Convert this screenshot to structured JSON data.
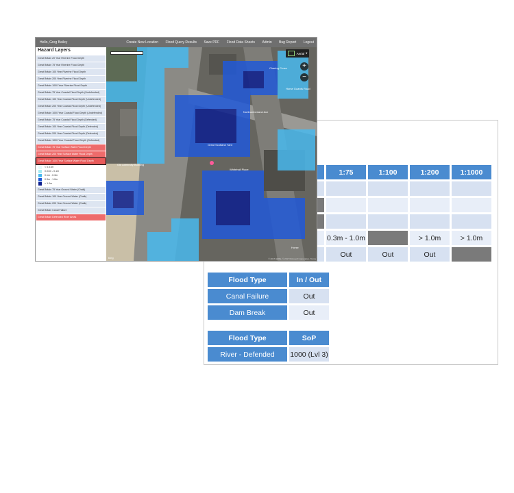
{
  "topbar": {
    "greeting": "Hello, Greg Bailey",
    "nav": [
      "Create New Location",
      "Flood Query Results",
      "Save PDF",
      "Flood Data Sheets",
      "Admin",
      "Bug Report",
      "Logout"
    ]
  },
  "sidebar": {
    "title": "Hazard Layers",
    "layers_top": [
      {
        "label": "Great Britain 20 Year Riverine Flood Depth",
        "style": "normal"
      },
      {
        "label": "Great Britain 75 Year Riverine Flood Depth",
        "style": "normal"
      },
      {
        "label": "Great Britain 100 Year Riverine Flood Depth",
        "style": "normal"
      },
      {
        "label": "Great Britain 200 Year Riverine Flood Depth",
        "style": "normal"
      },
      {
        "label": "Great Britain 1000 Year Riverine Flood Depth",
        "style": "normal"
      },
      {
        "label": "Great Britain 75 Year Coastal Flood Depth (Undefended)",
        "style": "normal"
      },
      {
        "label": "Great Britain 100 Year Coastal Flood Depth (Undefended)",
        "style": "normal"
      },
      {
        "label": "Great Britain 200 Year Coastal Flood Depth (Undefended)",
        "style": "normal"
      },
      {
        "label": "Great Britain 1000 Year Coastal Flood Depth (Undefended)",
        "style": "normal"
      },
      {
        "label": "Great Britain 75 Year Coastal Flood Depth (Defended)",
        "style": "normal"
      },
      {
        "label": "Great Britain 100 Year Coastal Flood Depth (Defended)",
        "style": "normal"
      },
      {
        "label": "Great Britain 200 Year Coastal Flood Depth (Defended)",
        "style": "normal"
      },
      {
        "label": "Great Britain 1000 Year Coastal Flood Depth (Defended)",
        "style": "normal"
      },
      {
        "label": "Great Britain 75 Year Surface Water Flood Depth",
        "style": "red"
      },
      {
        "label": "Great Britain 200 Year Surface Water Flood Depth",
        "style": "red"
      },
      {
        "label": "Great Britain 1000 Year Surface Water Flood Depth",
        "style": "active"
      }
    ],
    "legend": [
      {
        "label": "< 0.01m",
        "color": "#e6fbfb"
      },
      {
        "label": "0.01m - 0.1m",
        "color": "#a6ecf4"
      },
      {
        "label": "0.1m - 0.3m",
        "color": "#49b9ee"
      },
      {
        "label": "0.3m - 1.0m",
        "color": "#2159d8"
      },
      {
        "label": "> 1.0m",
        "color": "#0d1f8e"
      }
    ],
    "layers_bottom": [
      {
        "label": "Great Britain 75 Year Ground Water (Chalk)",
        "style": "normal"
      },
      {
        "label": "Great Britain 100 Year Ground Water (Chalk)",
        "style": "normal"
      },
      {
        "label": "Great Britain 200 Year Ground Water (Chalk)",
        "style": "normal"
      },
      {
        "label": "Great Britain Canal Failure",
        "style": "normal"
      },
      {
        "label": "Great Britain Defended River Areas",
        "style": "red"
      }
    ]
  },
  "map": {
    "labels": [
      "Charing Cross",
      "Old Admiralty Building",
      "Great Scotland Yard",
      "Whitehall Place",
      "Horse Guards Road",
      "Northumberland Ave",
      "Horse"
    ],
    "aerial_label": "Aerial",
    "zoom_in": "+",
    "zoom_out": "−",
    "attribution": "© 2017 HERE, © 2017 Microsoft Corporation, Terms",
    "brand": "bing"
  },
  "return_table": {
    "headers": [
      "1:75",
      "1:100",
      "1:200",
      "1:1000"
    ],
    "rows": [
      {
        "stub": "",
        "cells": [
          "",
          "",
          "",
          ""
        ]
      },
      {
        "stub": "",
        "cells": [
          "",
          "",
          "",
          ""
        ]
      },
      {
        "stub": "",
        "cells": [
          "",
          "",
          "",
          ""
        ]
      },
      {
        "stub": "",
        "cells": [
          "0.3m - 1.0m",
          "",
          "> 1.0m",
          "> 1.0m"
        ]
      },
      {
        "stub": "",
        "cells": [
          "Out",
          "Out",
          "Out",
          ""
        ]
      }
    ]
  },
  "flood_table_1": {
    "headers": [
      "Flood Type",
      "In / Out"
    ],
    "rows": [
      [
        "Canal Failure",
        "Out"
      ],
      [
        "Dam Break",
        "Out"
      ]
    ]
  },
  "flood_table_2": {
    "headers": [
      "Flood Type",
      "SoP"
    ],
    "rows": [
      [
        "River - Defended",
        "1000 (Lvl 3)"
      ]
    ]
  }
}
